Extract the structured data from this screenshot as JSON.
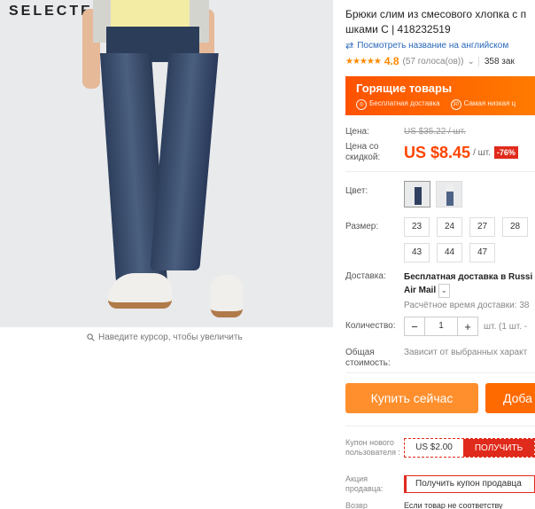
{
  "image": {
    "brand": "SELECTED",
    "zoom_hint": "Наведите курсор, чтобы увеличить"
  },
  "product": {
    "title_line1": "Брюки слим из смесового хлопка с п",
    "title_line2": "шками С | 418232519",
    "translate_link": "Посмотреть название на английском",
    "stars": "★★★★★",
    "rating": "4.8",
    "votes": "(57 голоса(ов))",
    "orders": "358 зак"
  },
  "hot_deals": {
    "title": "Горящие товары",
    "feature_1": "Бесплатная доставка",
    "feature_2": "Самая низкая ц",
    "feature_1_num": "",
    "feature_2_num": "30"
  },
  "price": {
    "label_price": "Цена:",
    "old_price": "US $35.22 / шт.",
    "label_discount": "Цена со скидкой:",
    "new_price": "US $8.45",
    "unit": "/ шт.",
    "discount": "-76%"
  },
  "options": {
    "color_label": "Цвет:",
    "size_label": "Размер:",
    "sizes": [
      "23",
      "24",
      "27",
      "28",
      "43",
      "44",
      "47"
    ]
  },
  "shipping": {
    "label": "Доставка:",
    "method": "Бесплатная доставка в Russi",
    "carrier": "Air Mail",
    "estimate": "Расчётное время доставки: 38"
  },
  "quantity": {
    "label": "Количество:",
    "minus": "−",
    "value": "1",
    "plus": "+",
    "note": "шт. (1 шт. -"
  },
  "total": {
    "label": "Общая стоимость:",
    "value": "Зависит от выбранных характ"
  },
  "buttons": {
    "buy_now": "Купить сейчас",
    "add_to_cart": "Доба"
  },
  "coupons": {
    "new_user_label": "Купон нового пользователя :",
    "new_user_value": "US $2.00",
    "get": "ПОЛУЧИТЬ",
    "seller_label": "Акция продавца:",
    "seller_value": "Получить купон продавца",
    "cut_label": "Возвр",
    "cut_value": "Если товар не соответству"
  },
  "colors": {
    "accent": "#ff6a00",
    "price": "#ff4400",
    "discount_bg": "#e02a1b",
    "link": "#2a68b8"
  }
}
